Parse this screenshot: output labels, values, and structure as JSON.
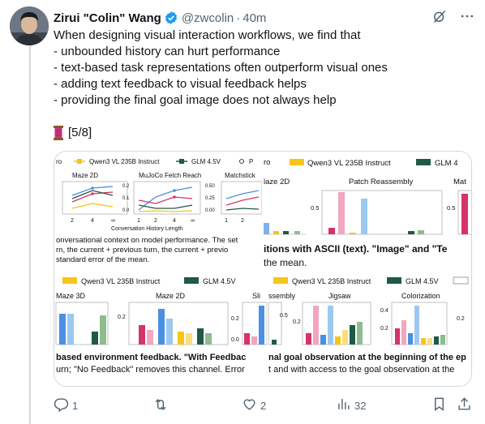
{
  "author": {
    "name": "Zirui \"Colin\" Wang",
    "handle": "@zwcolin",
    "separator": "·",
    "time": "40m"
  },
  "tweet": {
    "lines": [
      "When designing visual interaction workflows, we find that",
      "- unbounded history can hurt performance",
      "- text-based task representations often outperform visual ones",
      "- adding text feedback to visual feedback helps",
      "- providing the final goal image does not always help"
    ],
    "counter": "[5/8]"
  },
  "media": {
    "panel_tl": {
      "legend": [
        "ro",
        "Qwen3 VL 235B Instruct",
        "GLM 4.5V",
        "P"
      ],
      "subplots": [
        "Maze 2D",
        "MuJoCo Fetch Reach",
        "Matchstick"
      ],
      "xticks": [
        "2",
        "4",
        "∞",
        "1",
        "2",
        "4",
        "∞",
        "1",
        "2"
      ],
      "yticks": [
        "0.2",
        "0.1",
        "0.0",
        "0.50",
        "0.25",
        "0.00"
      ],
      "xlabel": "Conversation History Length",
      "caption": [
        "onversational context on model performance. The set",
        "rn, the current + previous turn, the current + previo",
        "standard error of the mean."
      ]
    },
    "panel_tr": {
      "legend": [
        "ro",
        "Qwen3 VL 235B Instruct",
        "GLM 4"
      ],
      "subplots": [
        "laze 2D",
        "Patch Reassembly",
        "Mat"
      ],
      "yticks": [
        "0.5",
        "0.5"
      ],
      "caption": [
        "itions with ASCII (text). \"Image\" and \"Te",
        "the mean."
      ]
    },
    "panel_bl": {
      "legend": [
        "Qwen3 VL 235B Instruct",
        "GLM 4.5V"
      ],
      "subplots": [
        "Maze 3D",
        "Maze 2D",
        "Sli"
      ],
      "yticks": [
        "0.2",
        "0.2",
        "0.0"
      ],
      "caption": [
        "based environment feedback. \"With Feedbac",
        "urn; \"No Feedback\" removes this channel. Error"
      ]
    },
    "panel_br": {
      "legend": [
        "Qwen3 VL 235B Instruct",
        "GLM 4.5V"
      ],
      "subplots": [
        "ssembly",
        "Jigsaw",
        "Colorization"
      ],
      "yticks": [
        "0.5",
        "0.2",
        "0.4",
        "0.2",
        "0.2"
      ],
      "caption": [
        "nal goal observation at the beginning of the ep",
        "t and with access to the goal observation at the"
      ]
    }
  },
  "actions": {
    "replies": "1",
    "reposts": "",
    "likes": "2",
    "views": "32"
  },
  "colors": {
    "text": "#0f1419",
    "muted": "#536471",
    "verified": "#1d9bf0",
    "border": "#cfd9de",
    "pink": "#d6336c",
    "blue": "#4a90e2",
    "yellow": "#f5c518",
    "green": "#1e5a45"
  }
}
